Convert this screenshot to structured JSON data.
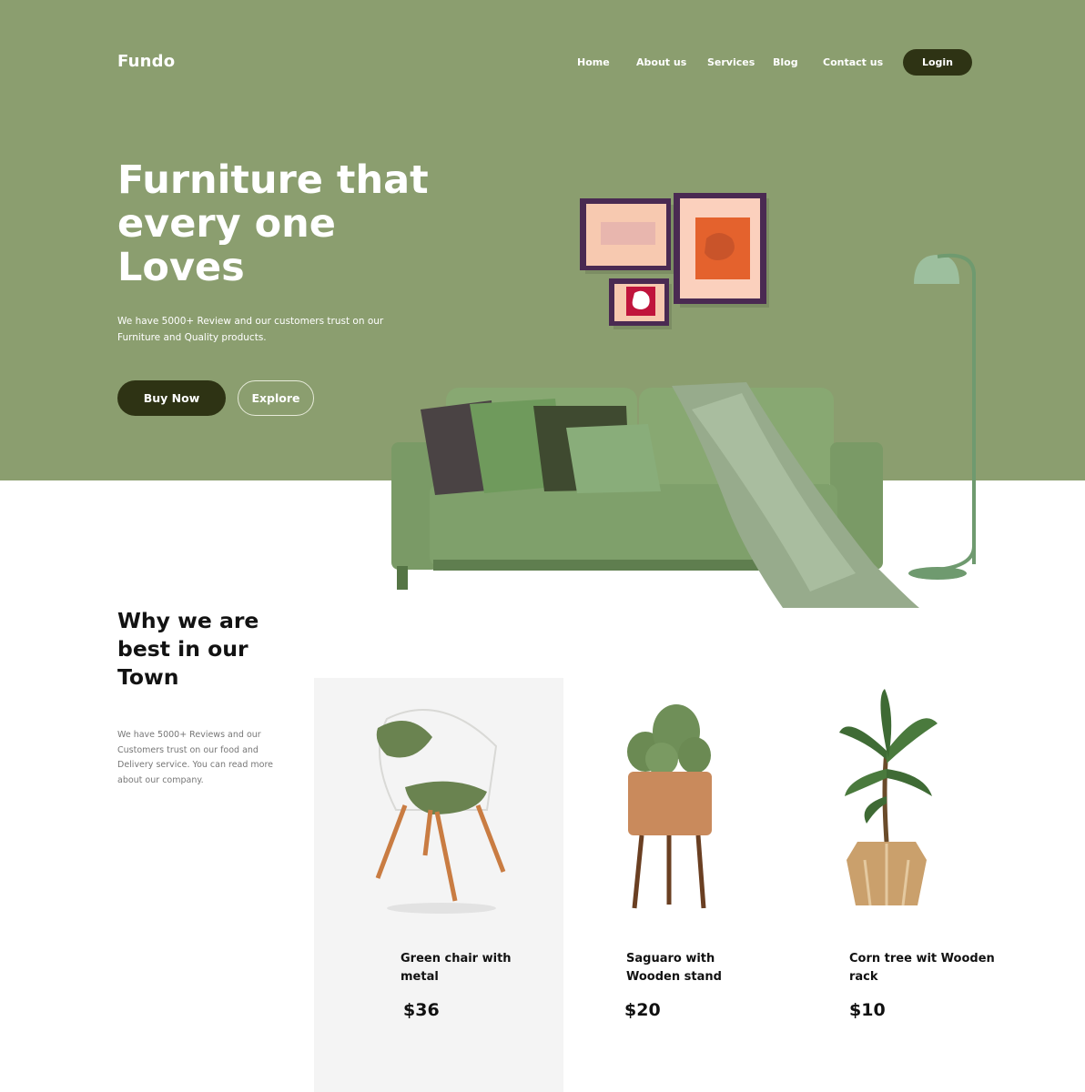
{
  "brand": {
    "logo": "Fundo"
  },
  "nav": {
    "items": [
      {
        "label": "Home"
      },
      {
        "label": "About us"
      },
      {
        "label": "Services"
      },
      {
        "label": "Blog"
      },
      {
        "label": "Contact us"
      }
    ],
    "login_label": "Login"
  },
  "hero": {
    "title": "Furniture that every one Loves",
    "subtitle": "We have 5000+ Review and our customers trust on our Furniture and Quality products.",
    "buy_label": "Buy Now",
    "explore_label": "Explore"
  },
  "why": {
    "title": "Why we are best in our Town",
    "subtitle": "We have 5000+ Reviews and our Customers trust on our food and Delivery service. You can read more about our company."
  },
  "products": [
    {
      "name": "Green chair with metal",
      "price": "$36"
    },
    {
      "name": "Saguaro with Wooden stand",
      "price": "$20"
    },
    {
      "name": "Corn tree wit Wooden rack",
      "price": "$10"
    }
  ],
  "colors": {
    "hero_green": "#8b9e6f",
    "dark_olive": "#2e3314",
    "sofa_green": "#7a9a66",
    "card_grey": "#f4f4f4"
  }
}
